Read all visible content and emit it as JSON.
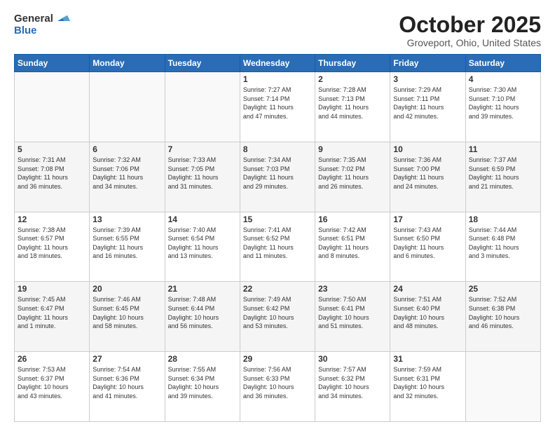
{
  "header": {
    "logo_general": "General",
    "logo_blue": "Blue",
    "month_title": "October 2025",
    "location": "Groveport, Ohio, United States"
  },
  "days_of_week": [
    "Sunday",
    "Monday",
    "Tuesday",
    "Wednesday",
    "Thursday",
    "Friday",
    "Saturday"
  ],
  "weeks": [
    [
      {
        "day": "",
        "info": ""
      },
      {
        "day": "",
        "info": ""
      },
      {
        "day": "",
        "info": ""
      },
      {
        "day": "1",
        "info": "Sunrise: 7:27 AM\nSunset: 7:14 PM\nDaylight: 11 hours\nand 47 minutes."
      },
      {
        "day": "2",
        "info": "Sunrise: 7:28 AM\nSunset: 7:13 PM\nDaylight: 11 hours\nand 44 minutes."
      },
      {
        "day": "3",
        "info": "Sunrise: 7:29 AM\nSunset: 7:11 PM\nDaylight: 11 hours\nand 42 minutes."
      },
      {
        "day": "4",
        "info": "Sunrise: 7:30 AM\nSunset: 7:10 PM\nDaylight: 11 hours\nand 39 minutes."
      }
    ],
    [
      {
        "day": "5",
        "info": "Sunrise: 7:31 AM\nSunset: 7:08 PM\nDaylight: 11 hours\nand 36 minutes."
      },
      {
        "day": "6",
        "info": "Sunrise: 7:32 AM\nSunset: 7:06 PM\nDaylight: 11 hours\nand 34 minutes."
      },
      {
        "day": "7",
        "info": "Sunrise: 7:33 AM\nSunset: 7:05 PM\nDaylight: 11 hours\nand 31 minutes."
      },
      {
        "day": "8",
        "info": "Sunrise: 7:34 AM\nSunset: 7:03 PM\nDaylight: 11 hours\nand 29 minutes."
      },
      {
        "day": "9",
        "info": "Sunrise: 7:35 AM\nSunset: 7:02 PM\nDaylight: 11 hours\nand 26 minutes."
      },
      {
        "day": "10",
        "info": "Sunrise: 7:36 AM\nSunset: 7:00 PM\nDaylight: 11 hours\nand 24 minutes."
      },
      {
        "day": "11",
        "info": "Sunrise: 7:37 AM\nSunset: 6:59 PM\nDaylight: 11 hours\nand 21 minutes."
      }
    ],
    [
      {
        "day": "12",
        "info": "Sunrise: 7:38 AM\nSunset: 6:57 PM\nDaylight: 11 hours\nand 18 minutes."
      },
      {
        "day": "13",
        "info": "Sunrise: 7:39 AM\nSunset: 6:55 PM\nDaylight: 11 hours\nand 16 minutes."
      },
      {
        "day": "14",
        "info": "Sunrise: 7:40 AM\nSunset: 6:54 PM\nDaylight: 11 hours\nand 13 minutes."
      },
      {
        "day": "15",
        "info": "Sunrise: 7:41 AM\nSunset: 6:52 PM\nDaylight: 11 hours\nand 11 minutes."
      },
      {
        "day": "16",
        "info": "Sunrise: 7:42 AM\nSunset: 6:51 PM\nDaylight: 11 hours\nand 8 minutes."
      },
      {
        "day": "17",
        "info": "Sunrise: 7:43 AM\nSunset: 6:50 PM\nDaylight: 11 hours\nand 6 minutes."
      },
      {
        "day": "18",
        "info": "Sunrise: 7:44 AM\nSunset: 6:48 PM\nDaylight: 11 hours\nand 3 minutes."
      }
    ],
    [
      {
        "day": "19",
        "info": "Sunrise: 7:45 AM\nSunset: 6:47 PM\nDaylight: 11 hours\nand 1 minute."
      },
      {
        "day": "20",
        "info": "Sunrise: 7:46 AM\nSunset: 6:45 PM\nDaylight: 10 hours\nand 58 minutes."
      },
      {
        "day": "21",
        "info": "Sunrise: 7:48 AM\nSunset: 6:44 PM\nDaylight: 10 hours\nand 56 minutes."
      },
      {
        "day": "22",
        "info": "Sunrise: 7:49 AM\nSunset: 6:42 PM\nDaylight: 10 hours\nand 53 minutes."
      },
      {
        "day": "23",
        "info": "Sunrise: 7:50 AM\nSunset: 6:41 PM\nDaylight: 10 hours\nand 51 minutes."
      },
      {
        "day": "24",
        "info": "Sunrise: 7:51 AM\nSunset: 6:40 PM\nDaylight: 10 hours\nand 48 minutes."
      },
      {
        "day": "25",
        "info": "Sunrise: 7:52 AM\nSunset: 6:38 PM\nDaylight: 10 hours\nand 46 minutes."
      }
    ],
    [
      {
        "day": "26",
        "info": "Sunrise: 7:53 AM\nSunset: 6:37 PM\nDaylight: 10 hours\nand 43 minutes."
      },
      {
        "day": "27",
        "info": "Sunrise: 7:54 AM\nSunset: 6:36 PM\nDaylight: 10 hours\nand 41 minutes."
      },
      {
        "day": "28",
        "info": "Sunrise: 7:55 AM\nSunset: 6:34 PM\nDaylight: 10 hours\nand 39 minutes."
      },
      {
        "day": "29",
        "info": "Sunrise: 7:56 AM\nSunset: 6:33 PM\nDaylight: 10 hours\nand 36 minutes."
      },
      {
        "day": "30",
        "info": "Sunrise: 7:57 AM\nSunset: 6:32 PM\nDaylight: 10 hours\nand 34 minutes."
      },
      {
        "day": "31",
        "info": "Sunrise: 7:59 AM\nSunset: 6:31 PM\nDaylight: 10 hours\nand 32 minutes."
      },
      {
        "day": "",
        "info": ""
      }
    ]
  ]
}
